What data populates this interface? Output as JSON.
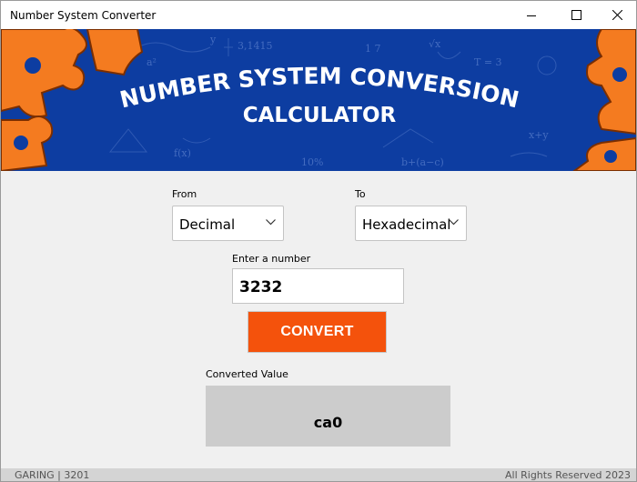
{
  "window": {
    "title": "Number System Converter"
  },
  "banner": {
    "line1": "NUMBER SYSTEM CONVERSION",
    "line2": "CALCULATOR"
  },
  "form": {
    "from_label": "From",
    "from_value": "Decimal",
    "to_label": "To",
    "to_value": "Hexadecimal",
    "input_label": "Enter a number",
    "input_value": "3232",
    "convert_label": "CONVERT",
    "output_label": "Converted Value",
    "output_value": "ca0"
  },
  "footer": {
    "left": "GARING | 3201",
    "right": "All Rights Reserved 2023"
  },
  "colors": {
    "banner_blue": "#0d3da1",
    "accent_orange": "#f4520c",
    "output_gray": "#cccccc"
  },
  "icons": [
    "minimize-icon",
    "maximize-icon",
    "close-icon",
    "chevron-down-icon"
  ]
}
